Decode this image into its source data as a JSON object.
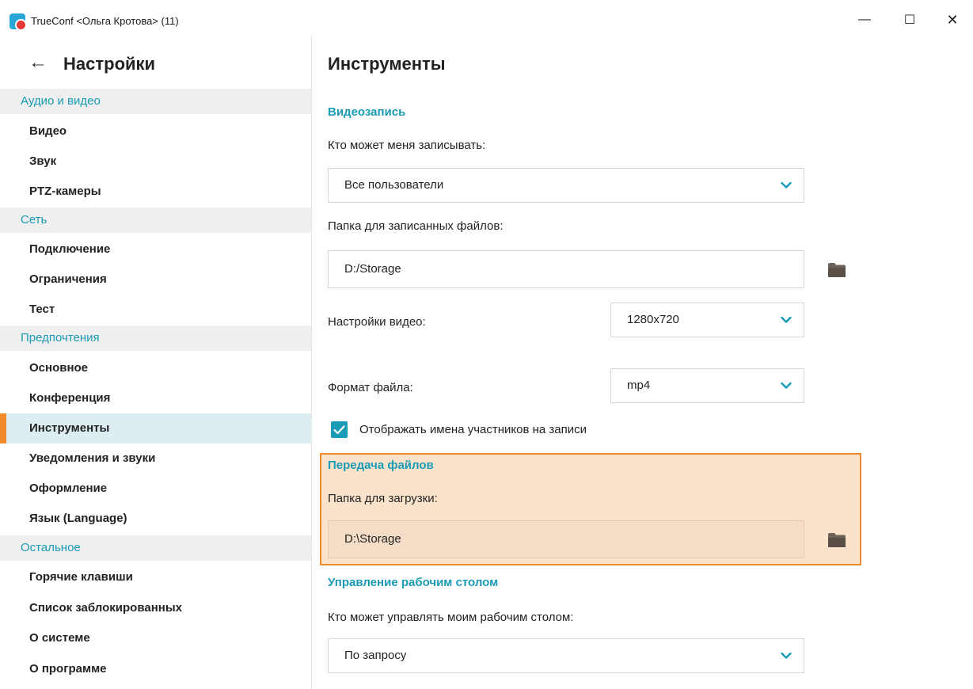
{
  "window": {
    "title": "TrueConf <Ольга Кротова> (11)",
    "controls": {
      "minimize": "—",
      "maximize": "☐",
      "close": "✕"
    }
  },
  "sidebar": {
    "title": "Настройки",
    "sections": [
      {
        "label": "Аудио и видео",
        "items": [
          "Видео",
          "Звук",
          "PTZ-камеры"
        ]
      },
      {
        "label": "Сеть",
        "items": [
          "Подключение",
          "Ограничения",
          "Тест"
        ]
      },
      {
        "label": "Предпочтения",
        "items": [
          "Основное",
          "Конференция",
          "Инструменты",
          "Уведомления и звуки",
          "Оформление",
          "Язык (Language)"
        ]
      },
      {
        "label": "Остальное",
        "items": [
          "Горячие клавиши",
          "Список заблокированных",
          "О системе",
          "О программе"
        ]
      }
    ],
    "active_item": "Инструменты"
  },
  "main": {
    "title": "Инструменты",
    "recording": {
      "header": "Видеозапись",
      "who_label": "Кто может меня записывать:",
      "who_value": "Все пользователи",
      "folder_label": "Папка для записанных файлов:",
      "folder_value": "D:/Storage",
      "video_label": "Настройки видео:",
      "video_value": "1280x720",
      "format_label": "Формат файла:",
      "format_value": "mp4",
      "show_names_label": "Отображать имена участников на записи",
      "show_names_checked": true
    },
    "file_transfer": {
      "header": "Передача файлов",
      "download_label": "Папка для загрузки:",
      "download_value": "D:\\Storage"
    },
    "desktop_control": {
      "header": "Управление рабочим столом",
      "who_label": "Кто может управлять моим рабочим столом:",
      "who_value": "По запросу"
    }
  },
  "colors": {
    "accent": "#1a9bb5",
    "active_marker": "#f08a2a",
    "highlight_fill": "#fbe2cb",
    "highlight_border": "#ee8a2e",
    "folder_icon": "#6e6358"
  }
}
